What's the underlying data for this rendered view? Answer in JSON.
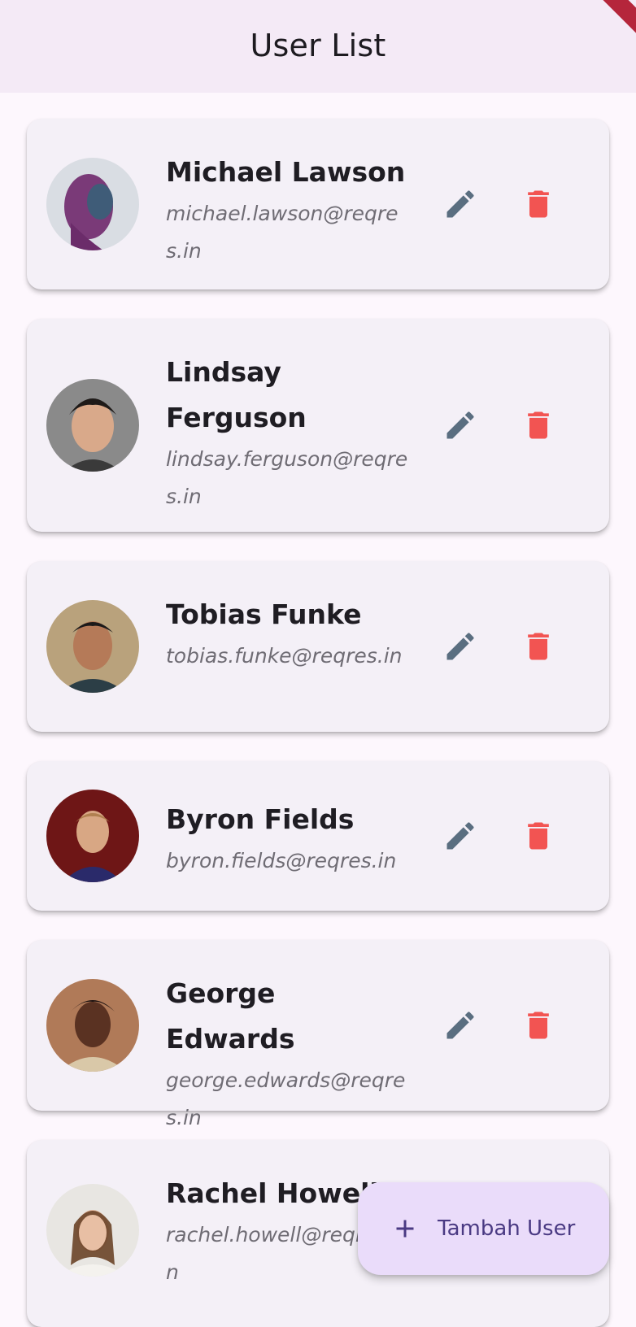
{
  "appbar": {
    "title": "User List"
  },
  "icons": {
    "edit": "pencil-icon",
    "delete": "trash-icon",
    "add": "plus-icon"
  },
  "colors": {
    "edit": "#5a6e80",
    "delete": "#f25452",
    "fab_bg": "#eadcfa",
    "fab_text": "#4a3a83"
  },
  "users": [
    {
      "name": "Michael Lawson",
      "email": "michael.lawson@reqres.in"
    },
    {
      "name": "Lindsay Ferguson",
      "email": "lindsay.ferguson@reqres.in"
    },
    {
      "name": "Tobias Funke",
      "email": "tobias.funke@reqres.in"
    },
    {
      "name": "Byron Fields",
      "email": "byron.fields@reqres.in"
    },
    {
      "name": "George Edwards",
      "email": "george.edwards@reqres.in"
    },
    {
      "name": "Rachel Howell",
      "email": "rachel.howell@reqres.in"
    }
  ],
  "fab": {
    "label": "Tambah User"
  }
}
